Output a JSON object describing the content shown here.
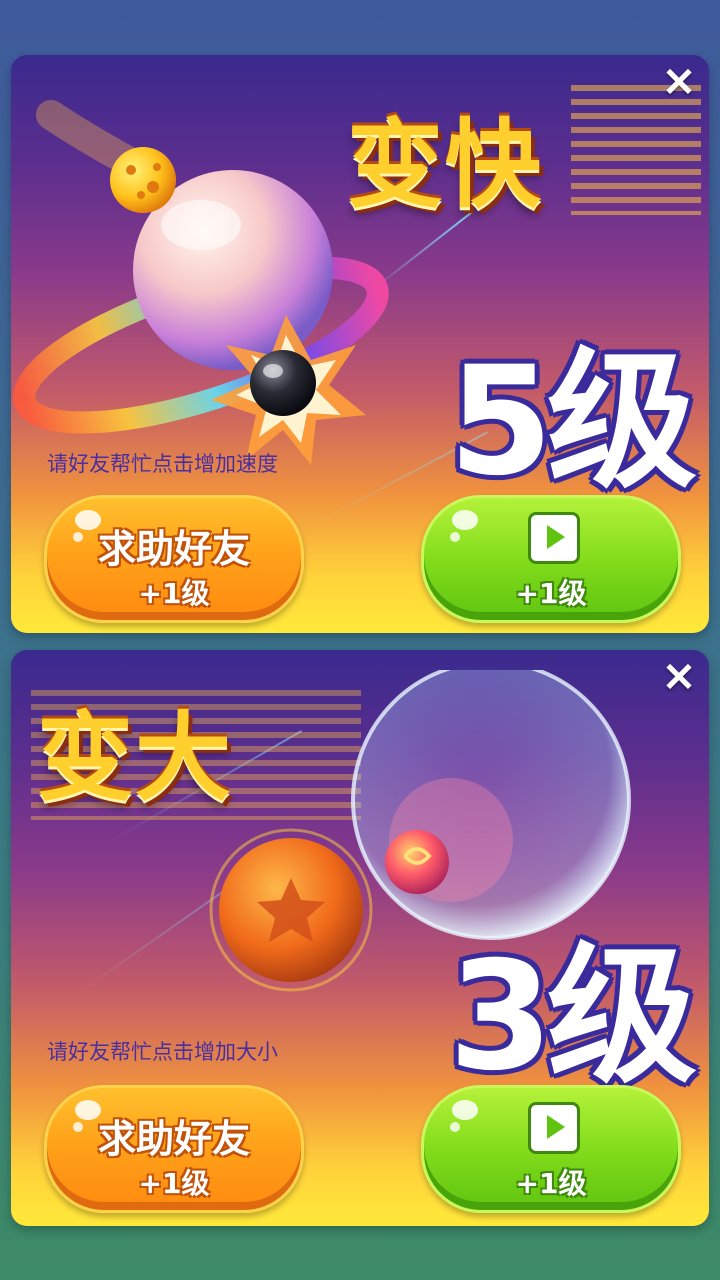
{
  "cards": [
    {
      "title": "变快",
      "level": "5级",
      "hint": "请好友帮忙点击增加速度",
      "help_button": {
        "label": "求助好友",
        "sub": "+1级"
      },
      "video_button": {
        "sub": "+1级"
      },
      "close": "✕"
    },
    {
      "title": "变大",
      "level": "3级",
      "hint": "请好友帮忙点击增加大小",
      "help_button": {
        "label": "求助好友",
        "sub": "+1级"
      },
      "video_button": {
        "sub": "+1级"
      },
      "close": "✕"
    }
  ],
  "icons": [
    "close-icon",
    "play-icon"
  ],
  "colors": {
    "title_gold": "#ffcf2e",
    "level_outline": "#3a2b9c",
    "orange_button": "#ffa21a",
    "green_button": "#7fda1a",
    "hint_text": "#4a2fa0"
  }
}
